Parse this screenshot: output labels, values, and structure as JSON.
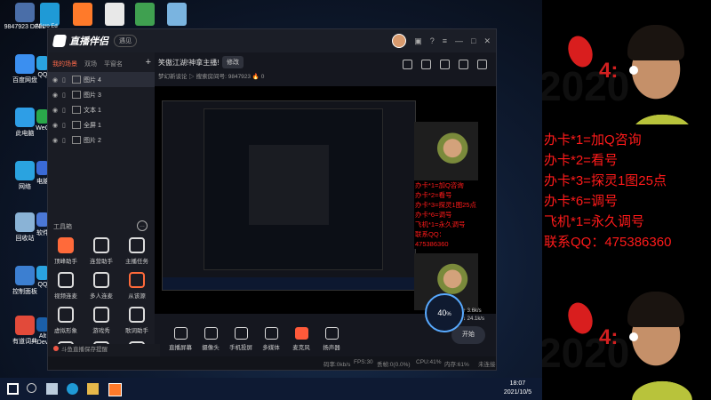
{
  "desktop": {
    "icons": [
      {
        "label": "9847923 DELL",
        "color": "#4a6ea8"
      },
      {
        "label": "百度网盘",
        "color": "#3b8ff0"
      },
      {
        "label": "此电脑",
        "color": "#2e9ee6"
      },
      {
        "label": "网络",
        "color": "#2aa3e0"
      },
      {
        "label": "回收站",
        "color": "#8ab3d6"
      },
      {
        "label": "控制面板",
        "color": "#3c7fd1"
      },
      {
        "label": "有道词典",
        "color": "#e24a3a"
      }
    ],
    "col2": [
      {
        "label": "QQ",
        "color": "#2aa3e0"
      },
      {
        "label": "WeC",
        "color": "#2aa84a"
      },
      {
        "label": "电脑",
        "color": "#3a6ad6"
      },
      {
        "label": "软件",
        "color": "#4b78d6"
      },
      {
        "label": "QQ",
        "color": "#2aa3e0"
      },
      {
        "label": "Alt Dev",
        "color": "#1b5fa8"
      }
    ],
    "top_icons": [
      {
        "label": "Micro Ed",
        "color": "#1f9ad6"
      },
      {
        "label": "",
        "color": "#ff7a2a"
      },
      {
        "label": "",
        "color": "#e8e8e8"
      },
      {
        "label": "",
        "color": "#3fa050"
      },
      {
        "label": "",
        "color": "#7ab4e0"
      }
    ]
  },
  "app": {
    "name": "直播伴侣",
    "badge": "遇见",
    "title_buttons": [
      "avatar",
      "skin-icon",
      "help-icon",
      "menu-icon",
      "minimize-icon",
      "restore-icon",
      "close-icon"
    ],
    "scene_tabs": [
      "我的场景",
      "双场",
      "平窗名"
    ],
    "sources": [
      {
        "label": "图片 4"
      },
      {
        "label": "图片 3"
      },
      {
        "label": "文本 1"
      },
      {
        "label": "全屏 1"
      },
      {
        "label": "图片 2"
      }
    ],
    "tools_title": "工具箱",
    "tools": [
      {
        "label": "顶峰助手",
        "style": "hot"
      },
      {
        "label": "连营助手",
        "style": ""
      },
      {
        "label": "主播任务",
        "style": ""
      },
      {
        "label": "视频连麦",
        "style": ""
      },
      {
        "label": "多人连麦",
        "style": ""
      },
      {
        "label": "从该源",
        "style": "hot2"
      },
      {
        "label": "虚拟形象",
        "style": ""
      },
      {
        "label": "游戏秀",
        "style": ""
      },
      {
        "label": "歌词助手",
        "style": ""
      },
      {
        "label": "",
        "style": ""
      },
      {
        "label": "",
        "style": ""
      },
      {
        "label": "",
        "style": ""
      }
    ],
    "warning": "斗鱼直播保存提醒",
    "stream": {
      "title": "笑傲江湖!神拿主播!",
      "edit_label": "修改",
      "meta": "梦幻新谈论   ▷   搜索房间号: 9847923   🔥 0"
    },
    "controls": [
      {
        "label": "直播屏幕",
        "style": ""
      },
      {
        "label": "摄像头",
        "style": ""
      },
      {
        "label": "手机投屏",
        "style": ""
      },
      {
        "label": "多媒体",
        "style": ""
      },
      {
        "label": "麦克风",
        "style": "live"
      },
      {
        "label": "扬声器",
        "style": ""
      }
    ],
    "go_label": "开始",
    "gauge": "40",
    "gauge_unit": "%",
    "speeds": [
      "↑ 3.6k/s",
      "↓ 24.1k/s"
    ],
    "status": [
      "码率:0kb/s",
      "FPS:30",
      "丢帧:0(0.0%)",
      "CPU:41%",
      "内存:61%",
      "未连接"
    ],
    "mini_text": [
      "办卡*1=加Q咨询",
      "办卡*2=看号",
      "办卡*3=探灵1图25点",
      "办卡*6=调号",
      "飞机*1=永久调号",
      "联系QQ：475386360"
    ]
  },
  "promo": {
    "number": "4:",
    "lines": [
      "办卡*1=加Q咨询",
      "办卡*2=看号",
      "办卡*3=探灵1图25点",
      "办卡*6=调号",
      "飞机*1=永久调号",
      "联系QQ：475386360"
    ]
  },
  "taskbar": {
    "time": "18:07",
    "date": "2021/10/5"
  }
}
